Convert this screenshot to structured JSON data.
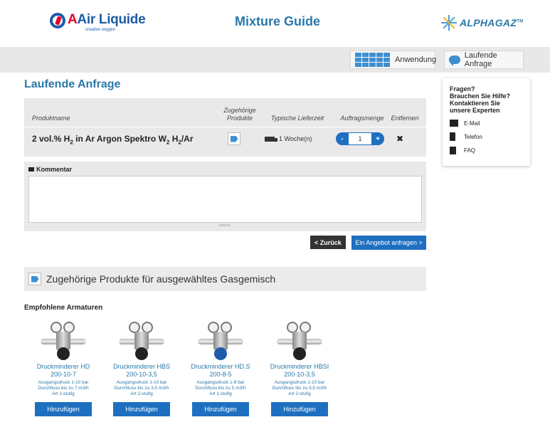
{
  "header": {
    "brand_left": "Air Liquide",
    "brand_left_tagline": "creative oxygen",
    "app_title": "Mixture Guide",
    "brand_right": "ALPHAGAZ",
    "brand_right_mark": "TM"
  },
  "nav": {
    "anwendung": "Anwendung",
    "laufende_anfrage": "Laufende Anfrage"
  },
  "page_title": "Laufende Anfrage",
  "table": {
    "col_produktname": "Produktname",
    "col_zugehoerige": "Zugehörige Produkte",
    "col_lieferzeit": "Typische Lieferzeit",
    "col_auftragsmenge": "Auftragsmenge",
    "col_entfernen": "Entfernen",
    "row": {
      "name_pre": "2 vol.% H",
      "name_sub1": "2",
      "name_mid": " in Ar Argon Spektro W",
      "name_sub2": "2",
      "name_mid2": " H",
      "name_sub3": "2",
      "name_post": "/Ar",
      "delivery": "1 Woche(n)",
      "qty_minus": "-",
      "qty_value": "1",
      "qty_plus": "+",
      "remove": "✖"
    }
  },
  "comment": {
    "label": "Kommentar",
    "value": ""
  },
  "buttons": {
    "back": "< Zurück",
    "offer": "Ein Angebot anfragen >"
  },
  "related": {
    "title": "Zugehörige Produkte für ausgewähltes Gasgemisch",
    "subhead": "Empfohlene Armaturen",
    "products": [
      {
        "name1": "Druckminderer HD",
        "name2": "200-10-7",
        "spec1": "Ausgangsdruck 1-10 bar",
        "spec2": "Durchfluss bis zu 7 m3/h",
        "spec3": "Art 1-stufig",
        "add": "Hinzufügen",
        "knob": "black"
      },
      {
        "name1": "Druckminderer HBS",
        "name2": "200-10-3,5",
        "spec1": "Ausgangsdruck 1-10 bar",
        "spec2": "Durchfluss bis zu 3,5 m3/h",
        "spec3": "Art 2-stufig",
        "add": "Hinzufügen",
        "knob": "black"
      },
      {
        "name1": "Druckminderer HD.S",
        "name2": "200-8-5",
        "spec1": "Ausgangsdruck 1-8 bar",
        "spec2": "Durchfluss bis zu 5 m3/h",
        "spec3": "Art 1-stufig",
        "add": "Hinzufügen",
        "knob": "blue"
      },
      {
        "name1": "Druckminderer HBSI",
        "name2": "200-10-3,5",
        "spec1": "Ausgangsdruck 1-10 bar",
        "spec2": "Durchfluss bis zu 3,5 m3/h",
        "spec3": "Art 2-stufig",
        "add": "Hinzufügen",
        "knob": "black"
      }
    ]
  },
  "help": {
    "title": "Fragen?\nBrauchen Sie Hilfe?\nKontaktieren Sie\nunsere Experten",
    "email": "E-Mail",
    "telefon": "Telefon",
    "faq": "FAQ"
  },
  "colors": {
    "accent_blue": "#2a78a8",
    "button_blue": "#1e6fc0",
    "grey_band": "#e8e8e8"
  }
}
